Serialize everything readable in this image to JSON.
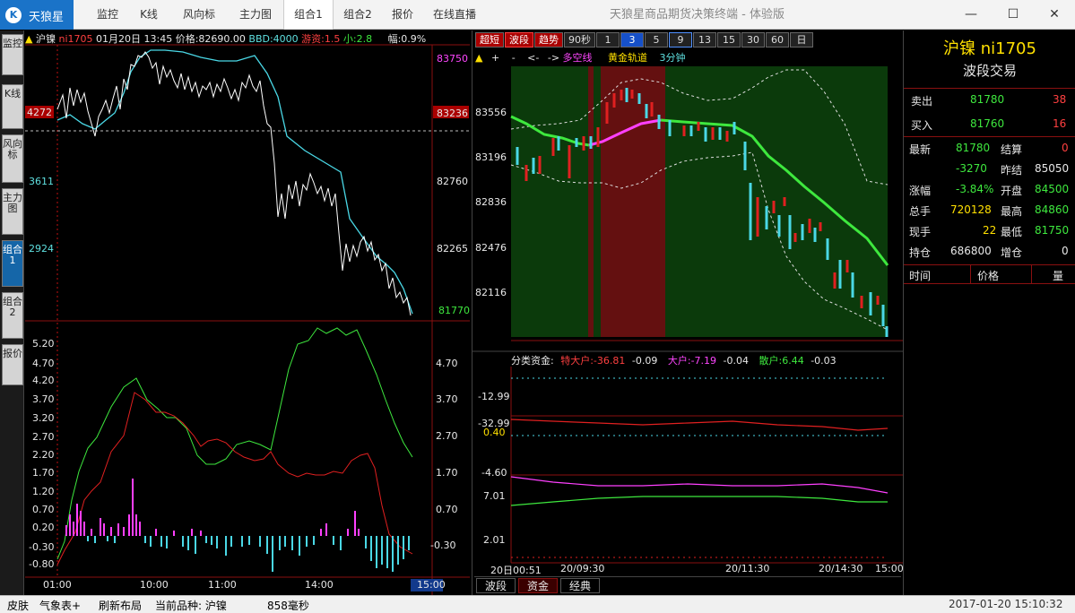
{
  "app": {
    "logo": "天狼星",
    "window_title": "天狼星商品期货决策终端 - 体验版"
  },
  "nav": [
    "监控",
    "K线",
    "风向标",
    "主力图",
    "组合1",
    "组合2",
    "报价",
    "在线直播"
  ],
  "nav_active": 4,
  "side_tabs": [
    "监控",
    "K线",
    "风向标",
    "主力图",
    "组合1",
    "组合2",
    "报价"
  ],
  "side_active": 4,
  "left": {
    "header": {
      "name": "沪镍",
      "code": "ni1705",
      "date": "01月20日",
      "time": "13:45",
      "price": "价格:82690.00",
      "bbd": "BBD:4000",
      "youzi": "游资:1.5",
      "xiao": "小:2.8",
      "fu": "幅:0.9%"
    },
    "left_labels": [
      "4272",
      "3611",
      "2924"
    ],
    "right_labels": [
      "83750",
      "83236",
      "82760",
      "82265",
      "81770"
    ],
    "osc_left": [
      "5.20",
      "4.70",
      "4.20",
      "3.70",
      "3.20",
      "2.70",
      "2.20",
      "1.70",
      "1.20",
      "0.70",
      "0.20",
      "-0.30",
      "-0.80"
    ],
    "osc_right": [
      "4.70",
      "3.70",
      "2.70",
      "1.70",
      "0.70",
      "-0.30"
    ],
    "times": [
      "01:00",
      "10:00",
      "11:00",
      "14:00",
      "15:00"
    ]
  },
  "mid": {
    "buttons": [
      "超短",
      "波段",
      "趋势",
      "90秒",
      "1",
      "3",
      "5",
      "9",
      "13",
      "15",
      "30",
      "60",
      "日"
    ],
    "tool": [
      "▲",
      "+",
      "-",
      "<-",
      "->",
      "多空线",
      "黄金轨道",
      "3分钟"
    ],
    "price_labels": [
      "83556",
      "83196",
      "82836",
      "82476",
      "82116"
    ],
    "fund": {
      "title": "分类资金:",
      "tdh": "特大户:-36.81",
      "tdh_v": "-0.09",
      "dh": "大户:-7.19",
      "dh_v": "-0.04",
      "sh": "散户:6.44",
      "sh_v": "-0.03"
    },
    "fund_labels": [
      "-12.99",
      "-32.99",
      "0.40",
      "-4.60",
      "7.01",
      "2.01"
    ],
    "times": [
      "20日00:51",
      "20/09:30",
      "20/11:30",
      "20/14:30",
      "15:00"
    ],
    "tabs": [
      "波段",
      "资金",
      "经典"
    ]
  },
  "right": {
    "title": "沪镍 ni1705",
    "subtitle": "波段交易",
    "sell": {
      "label": "卖出",
      "price": "81780",
      "vol": "38"
    },
    "buy": {
      "label": "买入",
      "price": "81760",
      "vol": "16"
    },
    "r1": {
      "a": "最新",
      "b": "81780",
      "c": "结算",
      "d": "0"
    },
    "r2": {
      "b": "-3270",
      "c": "昨结",
      "d": "85050"
    },
    "r3": {
      "a": "涨幅",
      "b": "-3.84%",
      "c": "开盘",
      "d": "84500"
    },
    "r4": {
      "a": "总手",
      "b": "720128",
      "c": "最高",
      "d": "84860"
    },
    "r5": {
      "a": "现手",
      "b": "22",
      "c": "最低",
      "d": "81750"
    },
    "r6": {
      "a": "持仓",
      "b": "686800",
      "c": "增仓",
      "d": "0"
    },
    "table": [
      "时间",
      "价格",
      "量"
    ]
  },
  "status": {
    "skin": "皮肤",
    "weather": "气象表+",
    "refresh": "刷新布局",
    "current": "当前品种: 沪镍",
    "ms": "858毫秒",
    "clock": "2017-01-20  15:10:32"
  }
}
